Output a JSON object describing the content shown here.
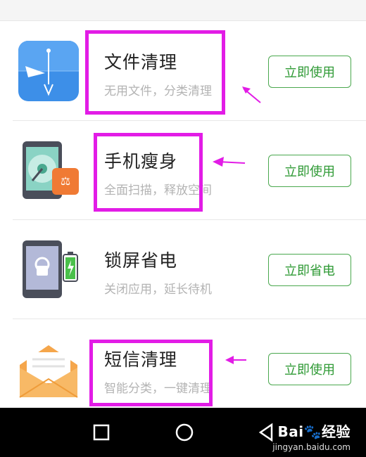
{
  "items": [
    {
      "title": "文件清理",
      "subtitle": "无用文件，分类清理",
      "action": "立即使用",
      "icon": "folder-clean-icon"
    },
    {
      "title": "手机瘦身",
      "subtitle": "全面扫描，释放空间",
      "action": "立即使用",
      "icon": "phone-storage-icon"
    },
    {
      "title": "锁屏省电",
      "subtitle": "关闭应用，延长待机",
      "action": "立即省电",
      "icon": "lockscreen-battery-icon"
    },
    {
      "title": "短信清理",
      "subtitle": "智能分类，一键清理",
      "action": "立即使用",
      "icon": "envelope-icon"
    }
  ],
  "navbar": {
    "buttons": [
      "recent-apps-icon",
      "home-icon",
      "back-icon"
    ]
  },
  "watermark": {
    "brand": "Bai",
    "brand2": "经验",
    "url": "jingyan.baidu.com"
  },
  "colors": {
    "accent": "#2f9a35",
    "highlight": "#e21ce6",
    "title": "#222222",
    "subtitle": "#b3b3b3"
  }
}
